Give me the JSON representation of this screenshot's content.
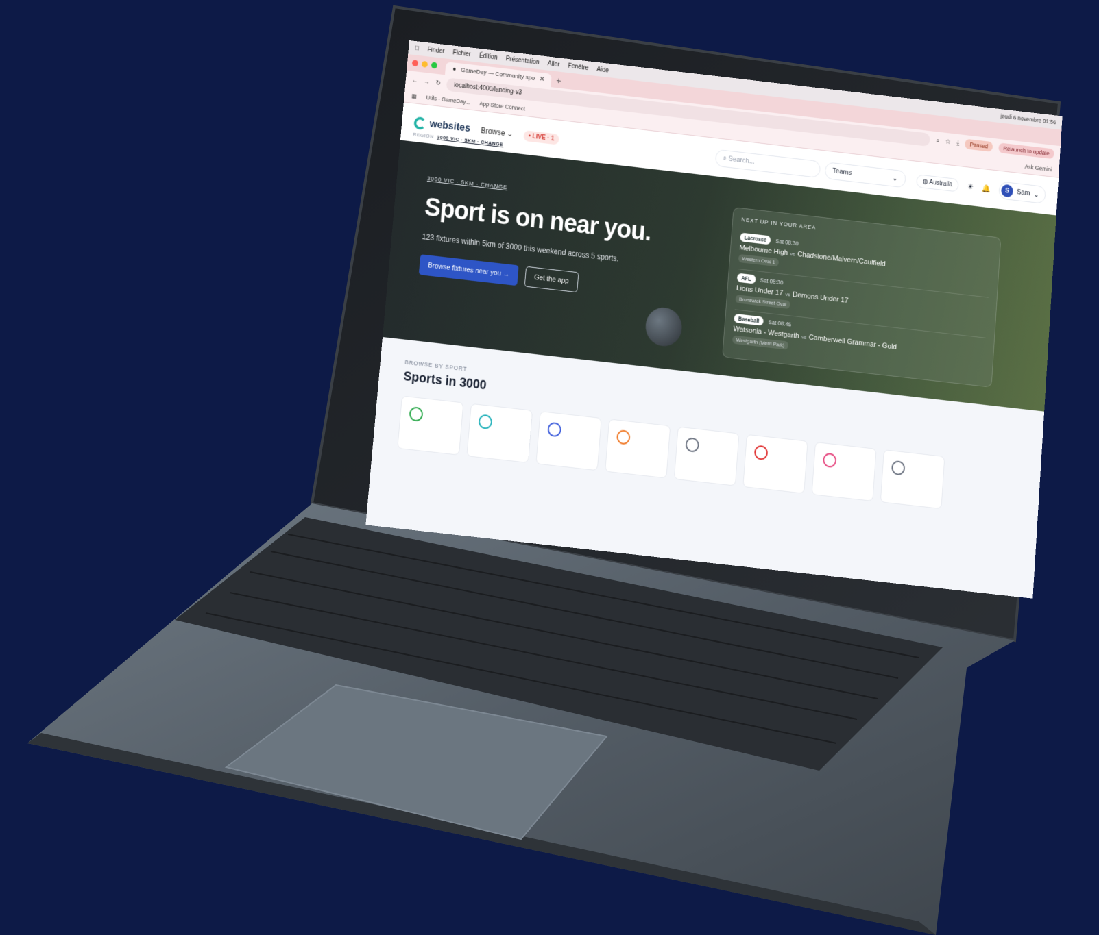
{
  "menubar": {
    "apple": "",
    "items": [
      "Finder",
      "Fichier",
      "Édition",
      "Présentation",
      "Aller",
      "Fenêtre",
      "Aide"
    ],
    "status": "jeudi 6 novembre 01:56"
  },
  "browser": {
    "tab_title": "GameDay — Community spo",
    "url": "localhost:4000/landing-v3",
    "bookmarks": [
      "Utils - GameDay...",
      "App Store Connect"
    ],
    "ask_gemini": "Ask Gemini",
    "paused": "Paused",
    "relaunch": "Relaunch to update"
  },
  "site": {
    "logo": "websites",
    "browse": "Browse",
    "live": "• LIVE · 1",
    "region_label": "REGION",
    "region_value": "3000 VIC · 5KM · CHANGE",
    "search_placeholder": "Search...",
    "teams": "Teams",
    "country": "Australia",
    "user_initial": "S",
    "user_name": "Sam"
  },
  "hero": {
    "location": "3000 VIC · 5KM · CHANGE",
    "title": "Sport is on near you.",
    "subtitle": "123 fixtures within 5km of 3000 this weekend across 5 sports.",
    "primary_cta": "Browse fixtures near you →",
    "secondary_cta": "Get the app"
  },
  "next_up": {
    "title": "NEXT UP IN YOUR AREA",
    "fixtures": [
      {
        "sport": "Lacrosse",
        "time": "Sat 08:30",
        "home": "Melbourne High",
        "away": "Chadstone/Malvern/Caulfield",
        "venue": "Western Oval 1"
      },
      {
        "sport": "AFL",
        "time": "Sat 08:30",
        "home": "Lions Under 17",
        "away": "Demons Under 17",
        "venue": "Brunswick Street Oval"
      },
      {
        "sport": "Baseball",
        "time": "Sat 08:45",
        "home": "Watsonia - Westgarth",
        "away": "Camberwell Grammar - Gold",
        "venue": "Westgarth (Merri Park)"
      }
    ],
    "vs": "vs"
  },
  "sports": {
    "kicker": "BROWSE BY SPORT",
    "title": "Sports in 3000",
    "icon_colors": [
      "#2aa84a",
      "#1fb0b9",
      "#3b5bdb",
      "#f07b2a",
      "#6b7280",
      "#e03131",
      "#e64980",
      "#6b7280"
    ]
  }
}
